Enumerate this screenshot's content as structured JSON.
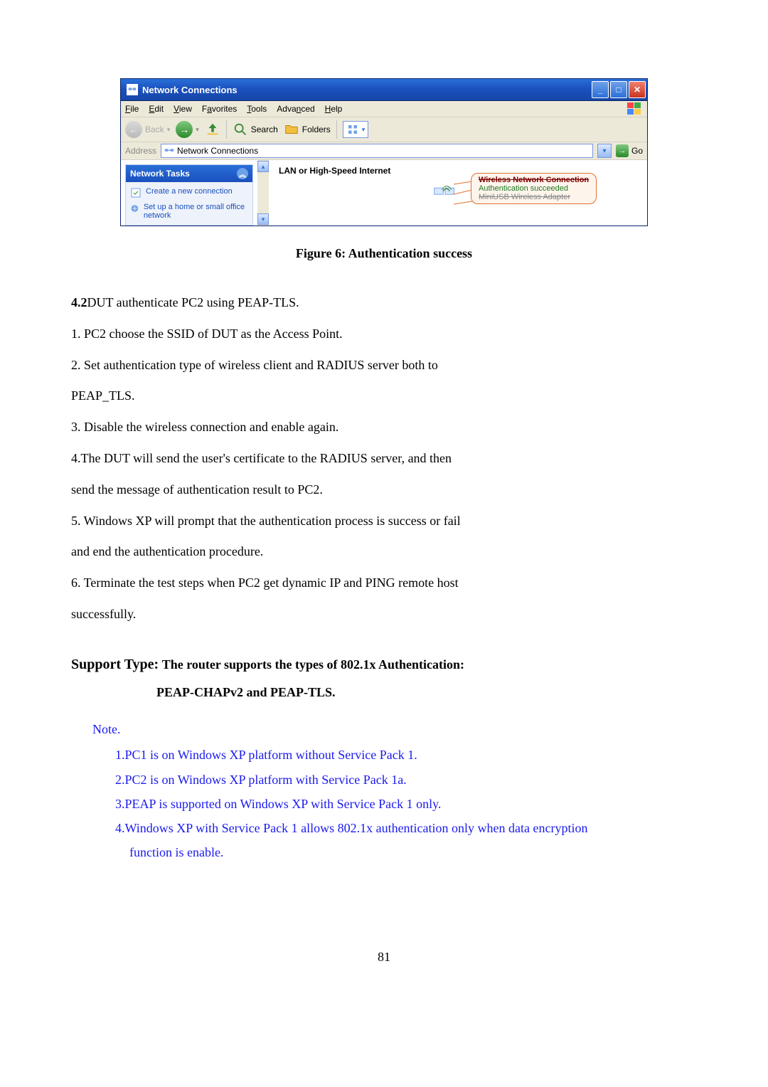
{
  "window": {
    "title": "Network Connections",
    "menus": [
      "File",
      "Edit",
      "View",
      "Favorites",
      "Tools",
      "Advanced",
      "Help"
    ],
    "menu_underline_idx": [
      0,
      0,
      0,
      1,
      0,
      4,
      0
    ],
    "toolbar": {
      "back_label": "Back",
      "search_label": "Search",
      "folders_label": "Folders"
    },
    "address": {
      "label": "Address",
      "value": "Network Connections",
      "go_label": "Go"
    },
    "task_pane": {
      "header": "Network Tasks",
      "items": [
        "Create a new connection",
        "Set up a home or small office network"
      ]
    },
    "section_header": "LAN or High-Speed Internet",
    "callout": {
      "line1": "Wireless Network Connection",
      "line2": "Authentication succeeded",
      "line3": "MiniUSB Wireless Adapter"
    }
  },
  "figure_caption": "Figure 6: Authentication success",
  "section42_lead": "4.2",
  "section42_title": "DUT authenticate PC2 using PEAP-TLS.",
  "steps": [
    "1.  PC2 choose the SSID of DUT as the Access Point.",
    "2.  Set authentication type of wireless client and RADIUS server both to",
    "PEAP_TLS.",
    "3.  Disable the wireless connection and enable again.",
    "4.The DUT will send the user's certificate to the RADIUS server, and then",
    "send the message of authentication result to PC2.",
    "5.  Windows XP will prompt that the authentication process is success or fail",
    "and end the authentication procedure.",
    "6.  Terminate the test steps when PC2 get dynamic IP and PING remote host",
    "successfully."
  ],
  "support_label": "Support Type:",
  "support_text": "The router supports the types of    802.1x Authentication:",
  "support_sub": "PEAP-CHAPv2 and PEAP-TLS.",
  "notes": {
    "label": "Note.",
    "items": [
      "1.PC1 is on Windows XP platform without Service Pack 1.",
      "2.PC2 is on Windows XP platform with Service Pack 1a.",
      "3.PEAP is supported on Windows XP with Service Pack 1 only.",
      "4.Windows XP with Service Pack 1 allows 802.1x authentication only when data encryption",
      "function is enable."
    ]
  },
  "page_number": "81"
}
